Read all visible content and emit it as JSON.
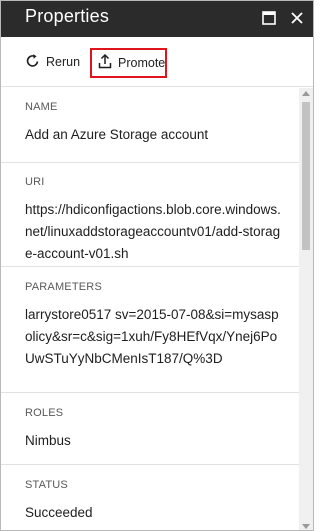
{
  "header": {
    "title": "Properties",
    "maximize_icon": "maximize-icon",
    "close_icon": "close-icon"
  },
  "toolbar": {
    "rerun_label": "Rerun",
    "rerun_icon": "refresh-icon",
    "promote_label": "Promote",
    "promote_icon": "upload-icon",
    "highlight_color": "#e0151b"
  },
  "fields": {
    "name": {
      "label": "NAME",
      "value": "Add an Azure Storage account"
    },
    "uri": {
      "label": "URI",
      "value": "https://hdiconfigactions.blob.core.windows.net/linuxaddstorageaccountv01/add-storage-account-v01.sh"
    },
    "parameters": {
      "label": "PARAMETERS",
      "value": "larrystore0517 sv=2015-07-08&si=mysaspolicy&sr=c&sig=1xuh/Fy8HEfVqx/Ynej6PoUwSTuYyNbCMenIsT187/Q%3D"
    },
    "roles": {
      "label": "ROLES",
      "value": "Nimbus"
    },
    "status": {
      "label": "STATUS",
      "value": "Succeeded"
    }
  },
  "colors": {
    "titlebar": "#2b2b2b",
    "title_text": "#ffffff",
    "label_text": "#595959",
    "value_text": "#1e1e1e"
  }
}
